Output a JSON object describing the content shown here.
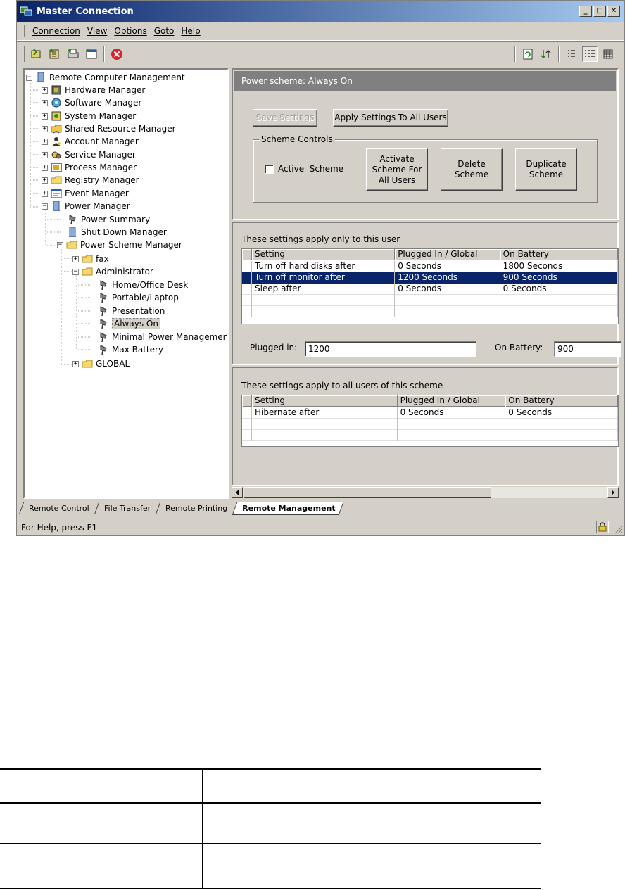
{
  "window": {
    "title": "Master Connection",
    "controls": {
      "minimize": "_",
      "maximize": "□",
      "close": "✕"
    }
  },
  "menu": {
    "items": [
      "Connection",
      "View",
      "Options",
      "Goto",
      "Help"
    ]
  },
  "toolbar": {
    "left_icons": [
      "connect-icon",
      "disconnect-icon",
      "print-icon",
      "properties-icon",
      "stop-icon"
    ],
    "right_icons": [
      "refresh-icon",
      "transfer-icon",
      "list-view-icon",
      "detail-view-icon",
      "report-view-icon"
    ]
  },
  "tree": {
    "root": "Remote Computer Management",
    "items": [
      {
        "label": "Hardware Manager",
        "icon": "hardware-icon"
      },
      {
        "label": "Software Manager",
        "icon": "software-icon"
      },
      {
        "label": "System Manager",
        "icon": "system-icon"
      },
      {
        "label": "Shared Resource Manager",
        "icon": "shared-resource-icon"
      },
      {
        "label": "Account Manager",
        "icon": "account-icon"
      },
      {
        "label": "Service Manager",
        "icon": "service-icon"
      },
      {
        "label": "Process Manager",
        "icon": "process-icon"
      },
      {
        "label": "Registry Manager",
        "icon": "registry-icon"
      },
      {
        "label": "Event Manager",
        "icon": "event-icon"
      },
      {
        "label": "Power Manager",
        "icon": "power-icon"
      }
    ],
    "power_children": [
      "Power Summary",
      "Shut Down Manager",
      "Power Scheme Manager"
    ],
    "scheme_folders": [
      "fax",
      "Administrator",
      "GLOBAL"
    ],
    "admin_schemes": [
      "Home/Office Desk",
      "Portable/Laptop",
      "Presentation",
      "Always On",
      "Minimal Power Management",
      "Max Battery"
    ],
    "selected": "Always On"
  },
  "scheme": {
    "header": "Power scheme: Always On",
    "save_button": "Save Settings",
    "apply_button": "Apply Settings To All Users",
    "controls_legend": "Scheme Controls",
    "active_label": "Active  Scheme",
    "activate_button": [
      "Activate",
      "Scheme For",
      "All Users"
    ],
    "delete_button": [
      "Delete",
      "Scheme"
    ],
    "duplicate_button": [
      "Duplicate",
      "Scheme"
    ]
  },
  "user_settings": {
    "label": "These settings apply only to this user",
    "columns": [
      "Setting",
      "Plugged In / Global",
      "On Battery"
    ],
    "rows": [
      [
        "Turn off hard disks after",
        "0 Seconds",
        "1800 Seconds"
      ],
      [
        "Turn off monitor after",
        "1200 Seconds",
        "900 Seconds"
      ],
      [
        "Sleep after",
        "0 Seconds",
        "0 Seconds"
      ]
    ],
    "selected_row": 1,
    "plugged_label": "Plugged in:",
    "plugged_value": "1200",
    "battery_label": "On Battery:",
    "battery_value": "900"
  },
  "all_users_settings": {
    "label": "These settings apply to all users of this scheme",
    "columns": [
      "Setting",
      "Plugged In / Global",
      "On Battery"
    ],
    "rows": [
      [
        "Hibernate after",
        "0 Seconds",
        "0 Seconds"
      ]
    ]
  },
  "tabs": [
    "Remote Control",
    "File Transfer",
    "Remote Printing",
    "Remote Management"
  ],
  "active_tab": "Remote Management",
  "status": {
    "text": "For Help, press F1"
  }
}
